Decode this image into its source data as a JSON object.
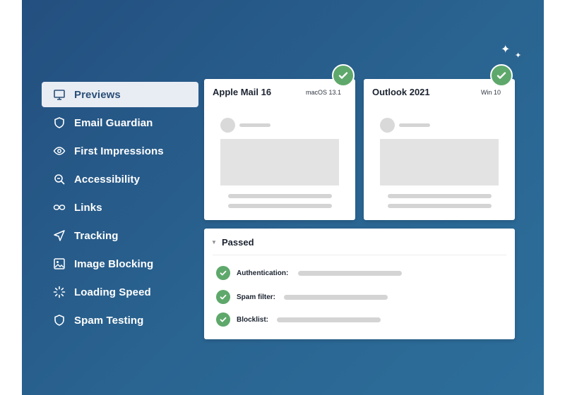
{
  "colors": {
    "background_gradient": [
      "#234f7f",
      "#2d6e9b"
    ],
    "active_item_bg": "#e8edf4",
    "success_green": "#5ea86b"
  },
  "sidebar": {
    "items": [
      {
        "label": "Previews",
        "icon": "monitor-icon",
        "active": true
      },
      {
        "label": "Email Guardian",
        "icon": "shield-icon",
        "active": false
      },
      {
        "label": "First Impressions",
        "icon": "eye-icon",
        "active": false
      },
      {
        "label": "Accessibility",
        "icon": "magnifier-icon",
        "active": false
      },
      {
        "label": "Links",
        "icon": "link-icon",
        "active": false
      },
      {
        "label": "Tracking",
        "icon": "send-icon",
        "active": false
      },
      {
        "label": "Image Blocking",
        "icon": "image-icon",
        "active": false
      },
      {
        "label": "Loading Speed",
        "icon": "spinner-icon",
        "active": false
      },
      {
        "label": "Spam Testing",
        "icon": "shield-icon",
        "active": false
      }
    ]
  },
  "previews": [
    {
      "client": "Apple Mail 16",
      "os": "macOS 13.1",
      "status_icon": "check-circle-icon"
    },
    {
      "client": "Outlook 2021",
      "os": "Win 10",
      "status_icon": "check-circle-icon"
    }
  ],
  "panel": {
    "title": "Passed",
    "checks": [
      {
        "label": "Authentication:",
        "icon": "check-circle-icon"
      },
      {
        "label": "Spam filter:",
        "icon": "check-circle-icon"
      },
      {
        "label": "Blocklist:",
        "icon": "check-circle-icon"
      }
    ]
  },
  "decorations": {
    "sparkle_icon": "sparkle-icon"
  }
}
